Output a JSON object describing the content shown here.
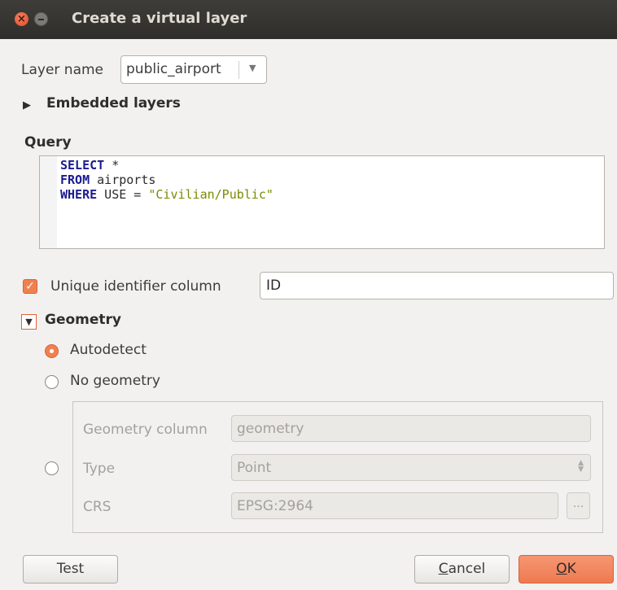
{
  "window": {
    "title": "Create a virtual layer",
    "close_icon": "close-icon",
    "minimize_icon": "minimize-icon"
  },
  "layer_name": {
    "label": "Layer name",
    "value": "public_airport"
  },
  "embedded_layers": {
    "label": "Embedded layers",
    "expanded": false
  },
  "query": {
    "label": "Query",
    "line1_kw": "SELECT",
    "line1_rest": " *",
    "line2_kw": "FROM",
    "line2_rest": " airports",
    "line3_kw": "WHERE",
    "line3_rest": " USE = ",
    "line3_str": "\"Civilian/Public\""
  },
  "unique_id": {
    "label": "Unique identifier column",
    "checked": true,
    "value": "ID"
  },
  "geometry": {
    "label": "Geometry",
    "expanded": true,
    "autodetect_label": "Autodetect",
    "no_geometry_label": "No geometry",
    "selected": "Autodetect",
    "column_label": "Geometry column",
    "column_value": "geometry",
    "type_label": "Type",
    "type_value": "Point",
    "crs_label": "CRS",
    "crs_value": "EPSG:2964",
    "crs_button": "..."
  },
  "buttons": {
    "test": "Test",
    "cancel_first": "C",
    "cancel_rest": "ancel",
    "ok_first": "O",
    "ok_rest": "K"
  },
  "colors": {
    "accent": "#f08050",
    "titlebar": "#3c3b37"
  }
}
